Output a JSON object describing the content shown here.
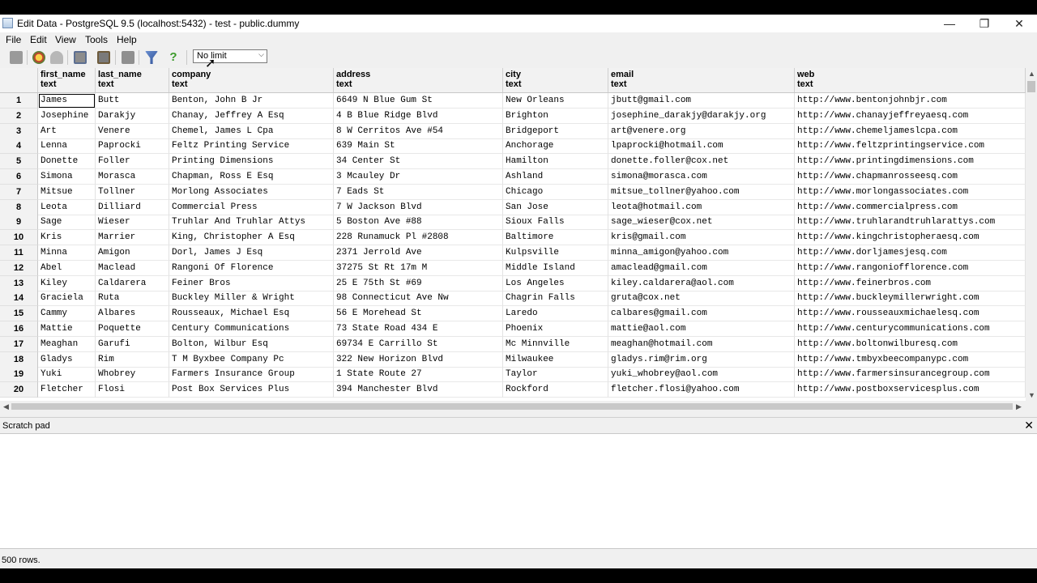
{
  "window": {
    "title": "Edit Data - PostgreSQL 9.5 (localhost:5432) - test - public.dummy",
    "minimize": "—",
    "maximize": "❐",
    "close": "✕"
  },
  "menu": [
    "File",
    "Edit",
    "View",
    "Tools",
    "Help"
  ],
  "toolbar": {
    "limit_value": "No limit",
    "icons": [
      "save-icon",
      "refresh-icon",
      "undo-icon",
      "copy-icon",
      "paste-icon",
      "delete-icon",
      "filter-icon",
      "help-icon"
    ]
  },
  "columns": [
    {
      "name": "first_name",
      "type": "text"
    },
    {
      "name": "last_name",
      "type": "text"
    },
    {
      "name": "company",
      "type": "text"
    },
    {
      "name": "address",
      "type": "text"
    },
    {
      "name": "city",
      "type": "text"
    },
    {
      "name": "email",
      "type": "text"
    },
    {
      "name": "web",
      "type": "text"
    }
  ],
  "rows": [
    [
      "1",
      "James",
      "Butt",
      "Benton, John B Jr",
      "6649 N Blue Gum St",
      "New Orleans",
      "jbutt@gmail.com",
      "http://www.bentonjohnbjr.com"
    ],
    [
      "2",
      "Josephine",
      "Darakjy",
      "Chanay, Jeffrey A Esq",
      "4 B Blue Ridge Blvd",
      "Brighton",
      "josephine_darakjy@darakjy.org",
      "http://www.chanayjeffreyaesq.com"
    ],
    [
      "3",
      "Art",
      "Venere",
      "Chemel, James L Cpa",
      "8 W Cerritos Ave #54",
      "Bridgeport",
      "art@venere.org",
      "http://www.chemeljameslcpa.com"
    ],
    [
      "4",
      "Lenna",
      "Paprocki",
      "Feltz Printing Service",
      "639 Main St",
      "Anchorage",
      "lpaprocki@hotmail.com",
      "http://www.feltzprintingservice.com"
    ],
    [
      "5",
      "Donette",
      "Foller",
      "Printing Dimensions",
      "34 Center St",
      "Hamilton",
      "donette.foller@cox.net",
      "http://www.printingdimensions.com"
    ],
    [
      "6",
      "Simona",
      "Morasca",
      "Chapman, Ross E Esq",
      "3 Mcauley Dr",
      "Ashland",
      "simona@morasca.com",
      "http://www.chapmanrosseesq.com"
    ],
    [
      "7",
      "Mitsue",
      "Tollner",
      "Morlong Associates",
      "7 Eads St",
      "Chicago",
      "mitsue_tollner@yahoo.com",
      "http://www.morlongassociates.com"
    ],
    [
      "8",
      "Leota",
      "Dilliard",
      "Commercial Press",
      "7 W Jackson Blvd",
      "San Jose",
      "leota@hotmail.com",
      "http://www.commercialpress.com"
    ],
    [
      "9",
      "Sage",
      "Wieser",
      "Truhlar And Truhlar Attys",
      "5 Boston Ave #88",
      "Sioux Falls",
      "sage_wieser@cox.net",
      "http://www.truhlarandtruhlarattys.com"
    ],
    [
      "10",
      "Kris",
      "Marrier",
      "King, Christopher A Esq",
      "228 Runamuck Pl #2808",
      "Baltimore",
      "kris@gmail.com",
      "http://www.kingchristopheraesq.com"
    ],
    [
      "11",
      "Minna",
      "Amigon",
      "Dorl, James J Esq",
      "2371 Jerrold Ave",
      "Kulpsville",
      "minna_amigon@yahoo.com",
      "http://www.dorljamesjesq.com"
    ],
    [
      "12",
      "Abel",
      "Maclead",
      "Rangoni Of Florence",
      "37275 St  Rt 17m M",
      "Middle Island",
      "amaclead@gmail.com",
      "http://www.rangoniofflorence.com"
    ],
    [
      "13",
      "Kiley",
      "Caldarera",
      "Feiner Bros",
      "25 E 75th St #69",
      "Los Angeles",
      "kiley.caldarera@aol.com",
      "http://www.feinerbros.com"
    ],
    [
      "14",
      "Graciela",
      "Ruta",
      "Buckley Miller & Wright",
      "98 Connecticut Ave Nw",
      "Chagrin Falls",
      "gruta@cox.net",
      "http://www.buckleymillerwright.com"
    ],
    [
      "15",
      "Cammy",
      "Albares",
      "Rousseaux, Michael Esq",
      "56 E Morehead St",
      "Laredo",
      "calbares@gmail.com",
      "http://www.rousseauxmichaelesq.com"
    ],
    [
      "16",
      "Mattie",
      "Poquette",
      "Century Communications",
      "73 State Road 434 E",
      "Phoenix",
      "mattie@aol.com",
      "http://www.centurycommunications.com"
    ],
    [
      "17",
      "Meaghan",
      "Garufi",
      "Bolton, Wilbur Esq",
      "69734 E Carrillo St",
      "Mc Minnville",
      "meaghan@hotmail.com",
      "http://www.boltonwilburesq.com"
    ],
    [
      "18",
      "Gladys",
      "Rim",
      "T M Byxbee Company Pc",
      "322 New Horizon Blvd",
      "Milwaukee",
      "gladys.rim@rim.org",
      "http://www.tmbyxbeecompanypc.com"
    ],
    [
      "19",
      "Yuki",
      "Whobrey",
      "Farmers Insurance Group",
      "1 State Route 27",
      "Taylor",
      "yuki_whobrey@aol.com",
      "http://www.farmersinsurancegroup.com"
    ],
    [
      "20",
      "Fletcher",
      "Flosi",
      "Post Box Services Plus",
      "394 Manchester Blvd",
      "Rockford",
      "fletcher.flosi@yahoo.com",
      "http://www.postboxservicesplus.com"
    ]
  ],
  "scratch_pad": {
    "label": "Scratch pad",
    "close": "✕"
  },
  "status": "500 rows."
}
